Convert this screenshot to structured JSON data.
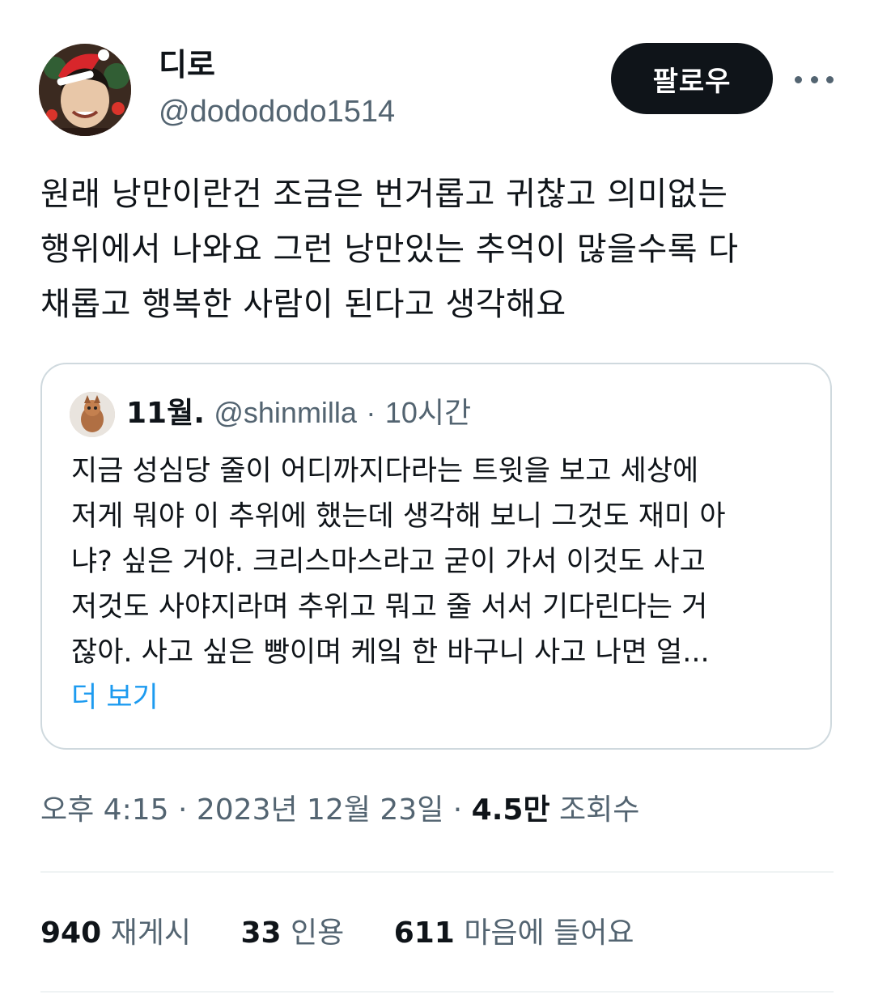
{
  "tweet": {
    "author": {
      "display_name": "디로",
      "handle": "@dodododo1514",
      "avatar_icon": "user-avatar"
    },
    "follow_label": "팔로우",
    "more_icon": "more-horizontal-icon",
    "text_lines": [
      "원래 낭만이란건 조금은 번거롭고 귀찮고 의미없는",
      "행위에서 나와요 그런 낭만있는 추억이 많을수록 다",
      "채롭고 행복한 사람이 된다고 생각해요"
    ],
    "quote": {
      "display_name": "11월.",
      "handle": "@shinmilla",
      "separator": "·",
      "time": "10시간",
      "text_lines": [
        "지금 성심당 줄이 어디까지다라는 트윗을 보고 세상에",
        "저게 뭐야 이 추위에 했는데 생각해 보니 그것도 재미 아",
        "냐? 싶은 거야. 크리스마스라고 굳이 가서 이것도 사고",
        "저것도 사야지라며 추위고 뭐고 줄 서서 기다린다는 거",
        "잖아. 사고 싶은 빵이며 케잌 한 바구니 사고 나면 얼..."
      ],
      "show_more": "더 보기"
    },
    "timestamp": "오후 4:15 · 2023년 12월 23일 · ",
    "views_count": "4.5만",
    "views_label": "조회수",
    "stats": {
      "retweets_count": "940",
      "retweets_label": "재게시",
      "quotes_count": "33",
      "quotes_label": "인용",
      "likes_count": "611",
      "likes_label": "마음에 들어요"
    },
    "colors": {
      "text_primary": "#0f1419",
      "text_secondary": "#536471",
      "link": "#1d9bf0",
      "border": "#cfd9de",
      "button_bg": "#0f1419"
    }
  }
}
